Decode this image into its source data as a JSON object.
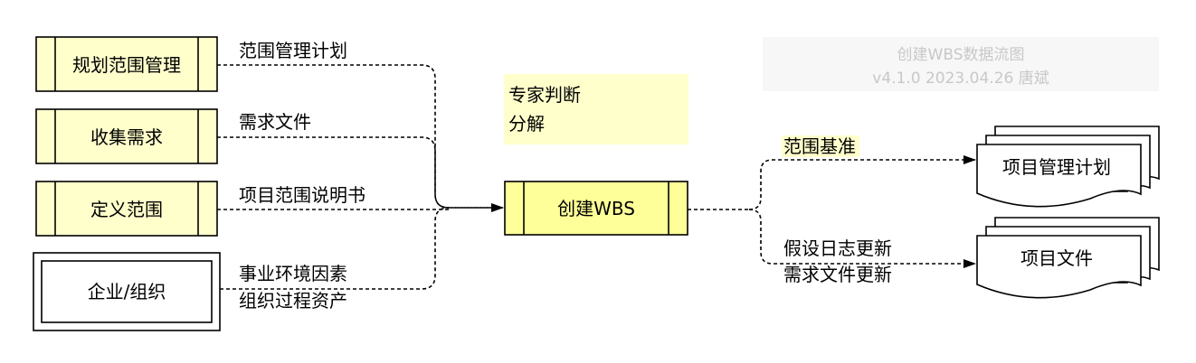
{
  "watermark": {
    "line1": "创建WBS数据流图",
    "line2": "v4.1.0    2023.04.26    唐斌"
  },
  "inputs": [
    {
      "process": "规划范围管理",
      "flow": "范围管理计划"
    },
    {
      "process": "收集需求",
      "flow": "需求文件"
    },
    {
      "process": "定义范围",
      "flow": "项目范围说明书"
    },
    {
      "process": "企业/组织",
      "flow_line1": "事业环境因素",
      "flow_line2": "组织过程资产"
    }
  ],
  "tools_note": {
    "line1": "专家判断",
    "line2": "分解"
  },
  "main_process": "创建WBS",
  "outputs": [
    {
      "flow": "范围基准",
      "target": "项目管理计划"
    },
    {
      "flow_line1": "假设日志更新",
      "flow_line2": "需求文件更新",
      "target": "项目文件"
    }
  ],
  "colors": {
    "process_fill": "#ffffcc",
    "main_fill": "#ffff99",
    "note_fill": "#ffffcc",
    "watermark_bg": "#f7f7f7"
  }
}
